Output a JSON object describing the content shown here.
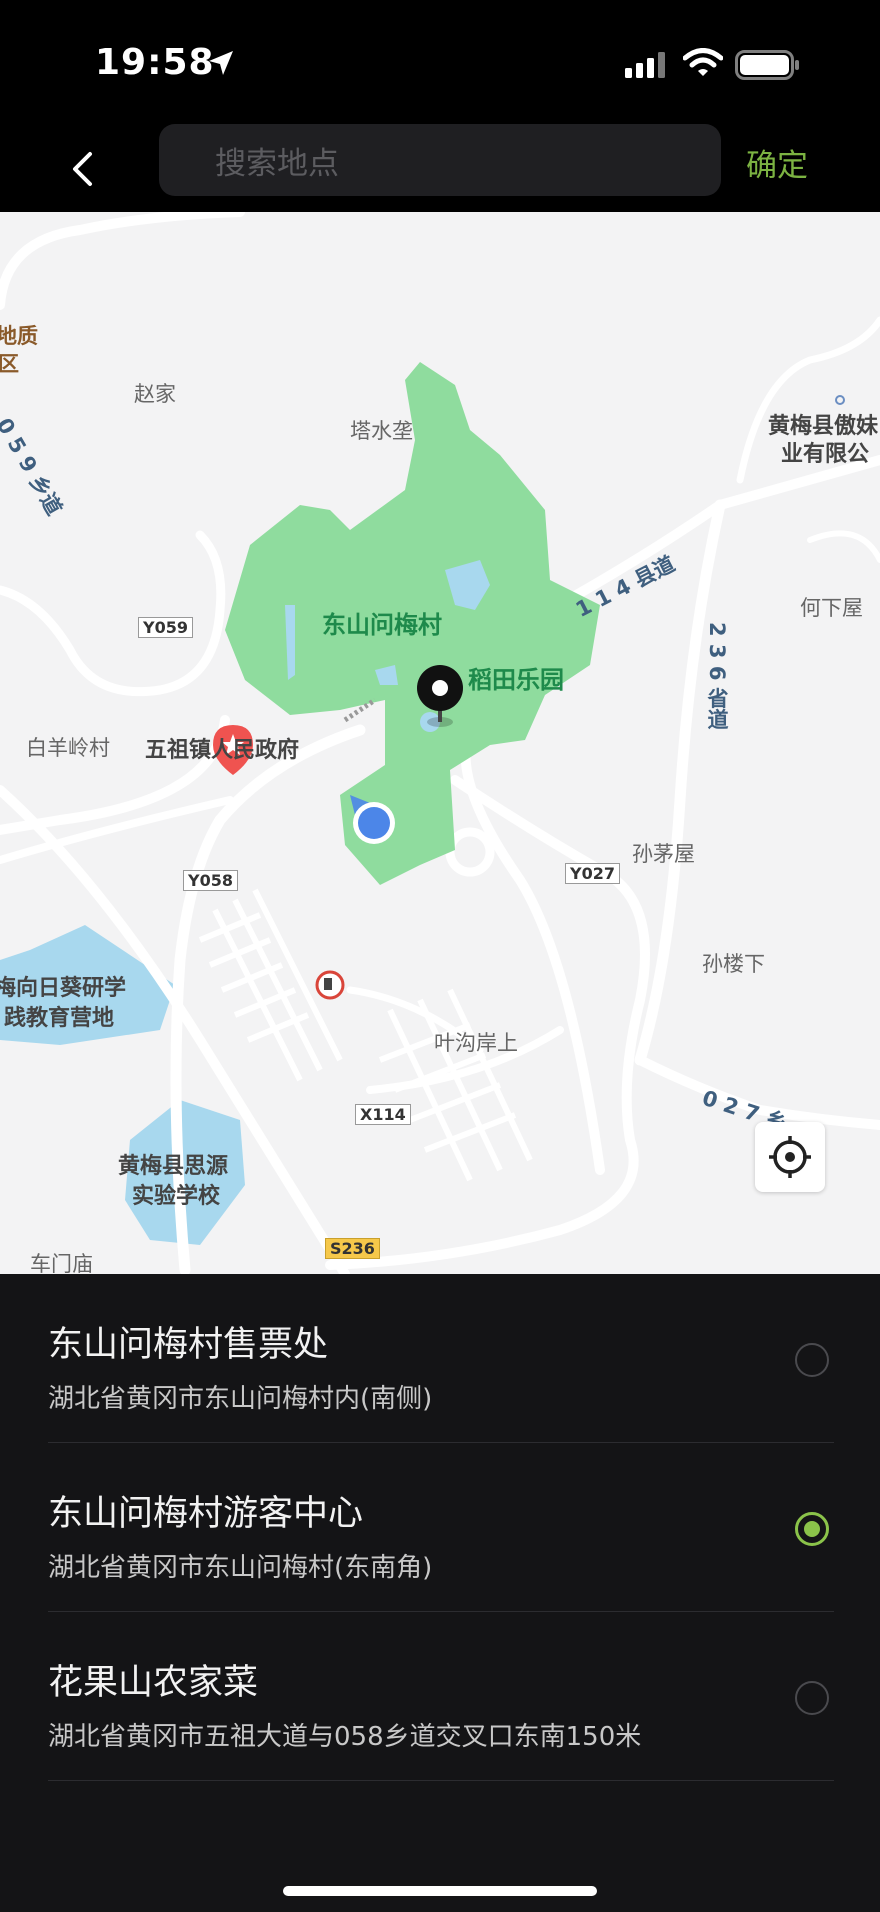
{
  "status_bar": {
    "time": "19:58"
  },
  "header": {
    "search_placeholder": "搜索地点",
    "confirm_label": "确定"
  },
  "map": {
    "labels": {
      "dizhi": "地质",
      "qu": "区",
      "zhaojia": "赵家",
      "tashuiya": "塔水垄",
      "road059": "0 5 9 乡道",
      "huangmei_company_1": "黄梅县傲妹",
      "huangmei_company_2": "业有限公",
      "dongshan": "东山问梅村",
      "daotian": "稻田乐园",
      "road114": "1 1 4 县道",
      "road236": "2 3 6 省道",
      "hexiawu": "何下屋",
      "y059": "Y059",
      "baiyangling": "白羊岭村",
      "wuzu_gov": "五祖镇人民政府",
      "sunmaowu": "孙茅屋",
      "y058": "Y058",
      "y027": "Y027",
      "sunlouxia": "孙楼下",
      "sunflower_1": "梅向日葵研学",
      "sunflower_2": "践教育营地",
      "yegouanshang": "叶沟岸上",
      "road027": "0 2 7 乡",
      "x114": "X114",
      "siyuan_1": "黄梅县思源",
      "siyuan_2": "实验学校",
      "chemenmiao": "车门庙",
      "s236": "S236"
    }
  },
  "places": [
    {
      "title": "东山问梅村售票处",
      "address": "湖北省黄冈市东山问梅村内(南侧)",
      "selected": false
    },
    {
      "title": "东山问梅村游客中心",
      "address": "湖北省黄冈市东山问梅村(东南角)",
      "selected": true
    },
    {
      "title": "花果山农家菜",
      "address": "湖北省黄冈市五祖大道与058乡道交叉口东南150米",
      "selected": false
    }
  ],
  "colors": {
    "accent": "#8bc34a",
    "park_green": "#8fdc9e",
    "water": "#a8d8ee"
  }
}
